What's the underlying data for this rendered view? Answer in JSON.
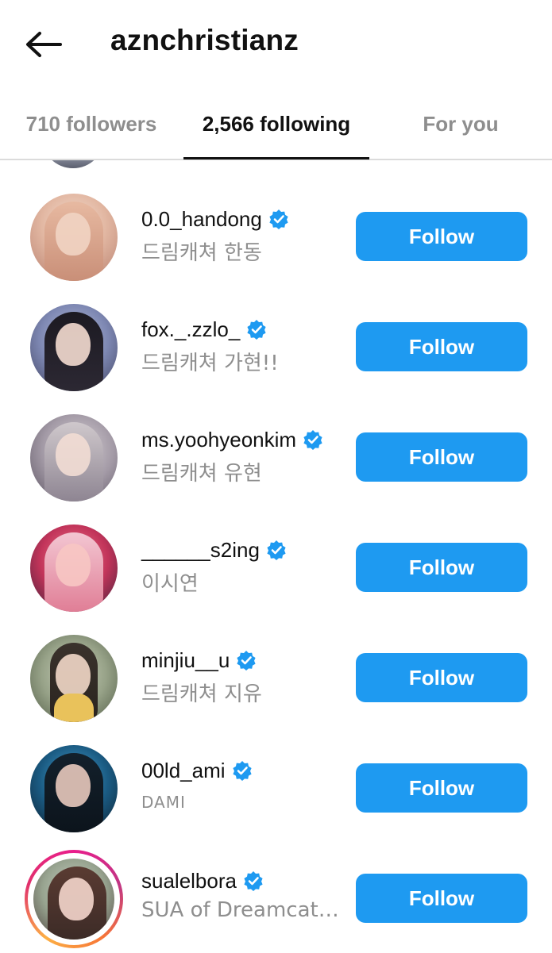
{
  "header": {
    "title": "aznchristianz",
    "back_icon": "arrow-left-icon"
  },
  "tabs": [
    {
      "label": "710 followers",
      "active": false
    },
    {
      "label": "2,566 following",
      "active": true
    },
    {
      "label": "For you",
      "active": false
    }
  ],
  "colors": {
    "accent": "#1e9af1",
    "verified": "#1e9af1",
    "muted_text": "#8e8e8e",
    "primary_text": "#111111"
  },
  "users": [
    {
      "username": "0.0_handong",
      "subtitle": "드림캐쳐 한동",
      "verified": true,
      "button": "Follow",
      "story": false,
      "avatar_colors": [
        "#e8c9b8",
        "#d4a48e",
        "#3a2d2a"
      ]
    },
    {
      "username": "fox._.zzlo_",
      "subtitle": "드림캐쳐 가현!!",
      "verified": true,
      "button": "Follow",
      "story": false,
      "avatar_colors": [
        "#9ea7c9",
        "#6f7aa6",
        "#1d1b26"
      ]
    },
    {
      "username": "ms.yoohyeonkim",
      "subtitle": "드림캐쳐 유현",
      "verified": true,
      "button": "Follow",
      "story": false,
      "avatar_colors": [
        "#c9c3c8",
        "#8e8592",
        "#4b4350"
      ]
    },
    {
      "username": "______s2ing",
      "subtitle": "이시연",
      "verified": true,
      "button": "Follow",
      "story": false,
      "avatar_colors": [
        "#e8546e",
        "#b02b52",
        "#3b2038"
      ]
    },
    {
      "username": "minjiu__u",
      "subtitle": "드림캐쳐 지유",
      "verified": true,
      "button": "Follow",
      "story": false,
      "avatar_colors": [
        "#a9b49a",
        "#e6c46b",
        "#4f5a44"
      ]
    },
    {
      "username": "00ld_ami",
      "subtitle": "DAMI",
      "verified": true,
      "button": "Follow",
      "story": false,
      "avatar_colors": [
        "#2f7fa8",
        "#164a6b",
        "#0b1c2a"
      ]
    },
    {
      "username": "sualelbora",
      "subtitle": "SUA of  Dreamcatc...",
      "verified": true,
      "button": "Follow",
      "story": true,
      "avatar_colors": [
        "#a7b2a3",
        "#d9a09a",
        "#4a3d3a"
      ]
    }
  ]
}
